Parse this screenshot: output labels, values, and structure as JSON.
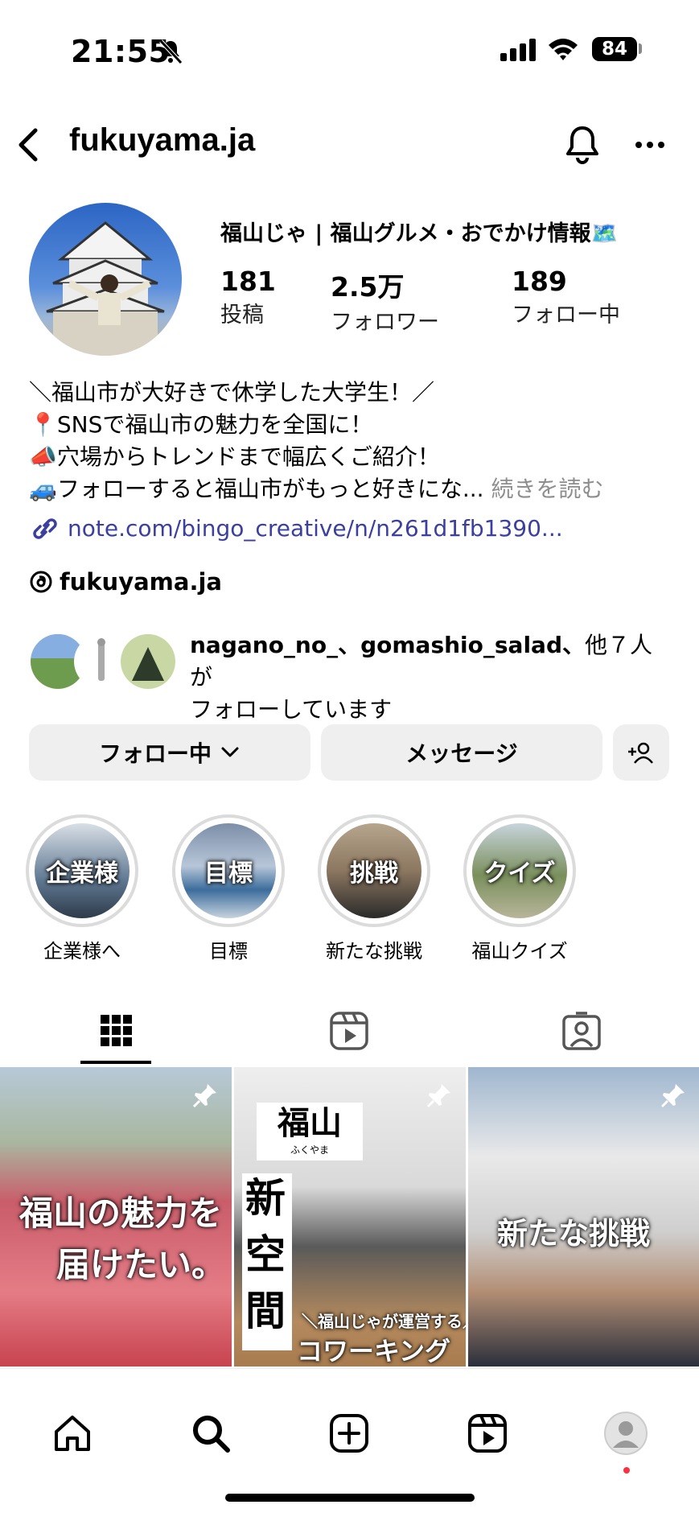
{
  "status_bar": {
    "time": "21:55",
    "battery": "84"
  },
  "header": {
    "username": "fukuyama.ja"
  },
  "profile": {
    "display_name": "福山じゃ | 福山グルメ・おでかけ情報🗺️",
    "stats": [
      {
        "value": "181",
        "label": "投稿"
      },
      {
        "value": "2.5万",
        "label": "フォロワー"
      },
      {
        "value": "189",
        "label": "フォロー中"
      }
    ],
    "bio": [
      "＼福山市が大好きで休学した大学生！／",
      "📍SNSで福山市の魅力を全国に！",
      "📣穴場からトレンドまで幅広くご紹介！",
      "🚙フォローすると福山市がもっと好きにな..."
    ],
    "bio_more": "続きを読む",
    "link": "note.com/bingo_creative/n/n261d1fb1390...",
    "threads_handle": "fukuyama.ja"
  },
  "mutual": {
    "names": "nagano_no_、gomashio_salad、",
    "suffix": "他７人が",
    "line2": "フォローしています"
  },
  "actions": {
    "following": "フォロー中",
    "message": "メッセージ"
  },
  "highlights": [
    {
      "title": "企業様",
      "label": "企業様へ"
    },
    {
      "title": "目標",
      "label": "目標"
    },
    {
      "title": "挑戦",
      "label": "新たな挑戦"
    },
    {
      "title": "クイズ",
      "label": "福山クイズ"
    }
  ],
  "posts": [
    {
      "line1": "福山の魅力を",
      "line2": "届けたい。"
    },
    {
      "badge": "福山",
      "badge_sub": "ふくやま",
      "vertical": "新空間",
      "sub": "＼福山じゃが運営する／",
      "main": "コワーキング"
    },
    {
      "text": "新たな挑戦"
    }
  ],
  "colors": {
    "link": "#3a3fa0",
    "button_bg": "#efefef",
    "notification_dot": "#ff3040"
  }
}
